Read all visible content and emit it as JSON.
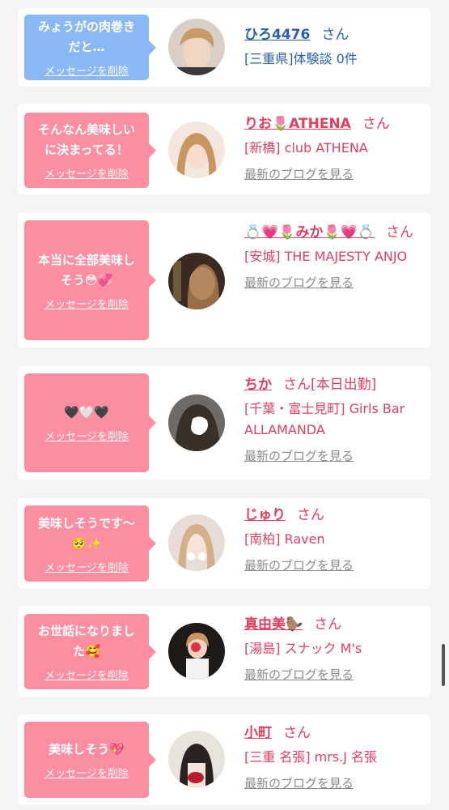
{
  "delete_label": "メッセージを削除",
  "blog_label": "最新のブログを見る",
  "san": "さん",
  "colors": {
    "pink": "#fb8ea1",
    "blue": "#8ab8f5",
    "name_pink": "#e03f62",
    "name_blue": "#2a5fa8"
  },
  "cards": [
    {
      "message": "みょうがの肉巻き\nだと…",
      "name": "ひろ4476",
      "status": "",
      "shop": "[三重県]体験談 0件",
      "has_blog": false
    },
    {
      "message": "そんなん美味しい\nに決まってる！",
      "name": "りお🌷ATHENA",
      "status": "",
      "shop": "[新橋] club ATHENA",
      "has_blog": true
    },
    {
      "message": "本当に全部美味し\nそう😳💞",
      "name": "💍💗🌷みか🌷💗💍",
      "status": "",
      "shop": "[安城] THE MAJESTY ANJO",
      "has_blog": true
    },
    {
      "message": "🖤🤍🖤",
      "name": "ちか",
      "status": "[本日出勤]",
      "shop": "[千葉・富士見町] Girls Bar ALLAMANDA",
      "has_blog": true
    },
    {
      "message": "美味しそうです～\n🥺✨",
      "name": "じゅり",
      "status": "",
      "shop": "[南柏] Raven",
      "has_blog": true
    },
    {
      "message": "お世話になりまし\nた🥰",
      "name": "真由美🦫",
      "status": "",
      "shop": "[湯島] スナック M's",
      "has_blog": true
    },
    {
      "message": "美味しそう💖",
      "name": "小町",
      "status": "",
      "shop": "[三重 名張] mrs.J 名張",
      "has_blog": true
    }
  ]
}
